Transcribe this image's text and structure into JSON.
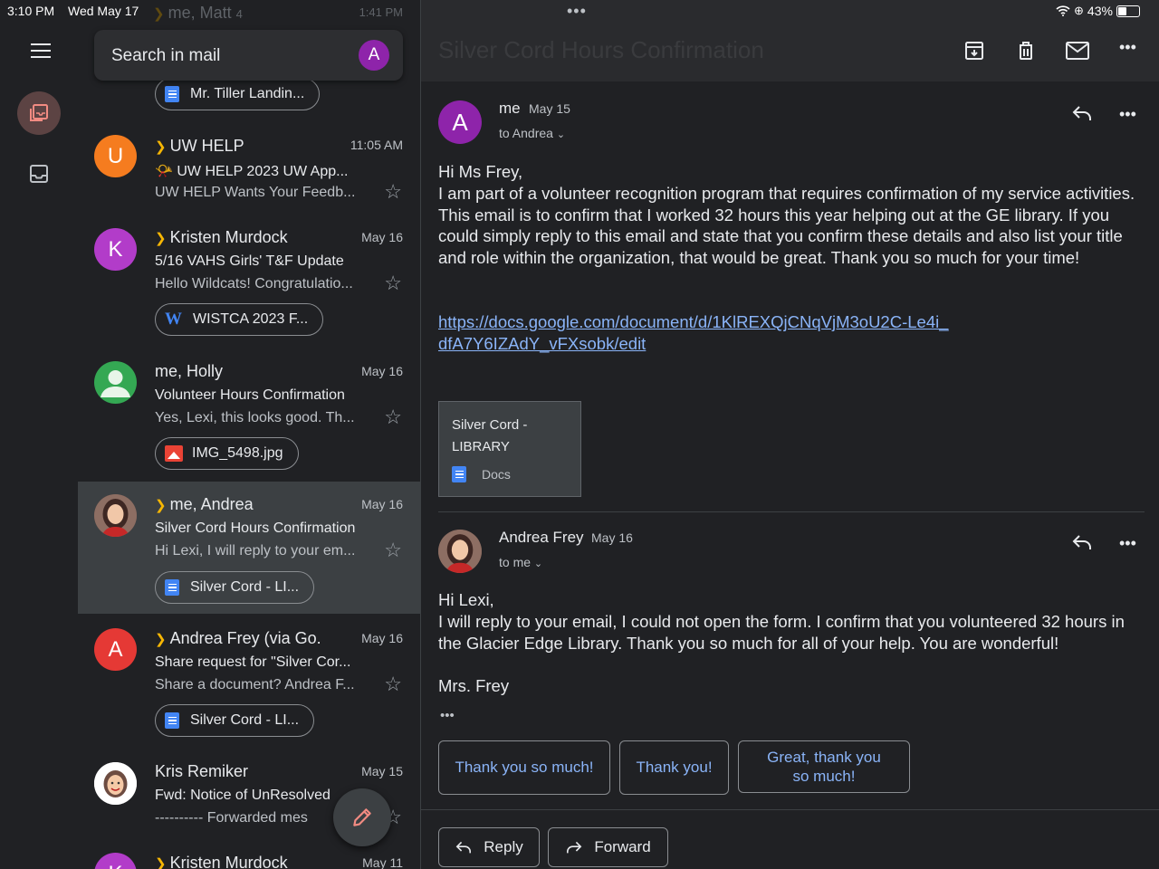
{
  "status_bar": {
    "time": "3:10 PM",
    "date": "Wed May 17",
    "battery": "43%"
  },
  "search": {
    "placeholder": "Search in mail",
    "account_initial": "A"
  },
  "top_partial": {
    "sender": "me, Matt",
    "count": "4",
    "time": "1:41 PM",
    "attachment": "Mr. Tiller Landin..."
  },
  "emails": [
    {
      "avatar_initial": "U",
      "avatar_color": "#f57c1f",
      "sender": "UW HELP",
      "important": true,
      "date": "11:05 AM",
      "subject": "📯 UW HELP 2023 UW App...",
      "snippet": "UW HELP Wants Your Feedb..."
    },
    {
      "avatar_initial": "K",
      "avatar_color": "#b23cc9",
      "sender": "Kristen Murdock",
      "important": true,
      "date": "May 16",
      "subject": "5/16 VAHS Girls' T&F Update",
      "snippet": "Hello Wildcats! Congratulatio...",
      "attachment": "WISTCA 2023 F..."
    },
    {
      "avatar_initial": "",
      "avatar_color": "#34a853",
      "sender": "me, Holly",
      "important": false,
      "date": "May 16",
      "subject": "Volunteer Hours Confirmation",
      "snippet": "Yes, Lexi, this looks good. Th...",
      "attachment": "IMG_5498.jpg"
    },
    {
      "avatar_initial": "",
      "avatar_color": "#7a4a3a",
      "sender": "me, Andrea",
      "important": true,
      "date": "May 16",
      "subject": "Silver Cord Hours Confirmation",
      "snippet": "Hi Lexi, I will reply to your em...",
      "attachment": "Silver Cord - LI..."
    },
    {
      "avatar_initial": "A",
      "avatar_color": "#e53935",
      "sender": "Andrea Frey (via Go.",
      "important": true,
      "date": "May 16",
      "subject": "Share request for \"Silver Cor...",
      "snippet": "Share a document? Andrea F...",
      "attachment": "Silver Cord - LI..."
    },
    {
      "avatar_initial": "",
      "avatar_color": "#ffffff",
      "sender": "Kris Remiker",
      "important": false,
      "date": "May 15",
      "subject": "Fwd: Notice of UnResolved",
      "snippet": "---------- Forwarded mes"
    },
    {
      "avatar_initial": "K",
      "avatar_color": "#b23cc9",
      "sender": "Kristen Murdock",
      "important": true,
      "date": "May 11"
    }
  ],
  "thread": {
    "title": "Silver Cord Hours Confirmation",
    "message1": {
      "avatar_initial": "A",
      "sender": "me",
      "date": "May 15",
      "to": "to Andrea",
      "greeting": "Hi Ms Frey,",
      "body": "I am part of a volunteer recognition program that requires confirmation of my service activities. This email is to confirm that I worked 32 hours this year helping out at the GE library. If you could simply reply to this email and state that you confirm these details and also list your title and role within the organization, that would be great. Thank you so much for your time!",
      "link_line1": "https://docs.google.com/document/d/1KlREXQjCNqVjM3oU2C-Le4i_",
      "link_line2": "dfA7Y6IZAdY_vFXsobk/edit",
      "attachment_title": "Silver Cord - LIBRARY",
      "attachment_type": "Docs"
    },
    "message2": {
      "sender": "Andrea Frey",
      "date": "May 16",
      "to": "to me",
      "line1": "Hi Lexi,",
      "line2": "I will reply to your email, I could not open the form.  I confirm that you volunteered 32 hours in the Glacier Edge Library.  Thank you so much for all of your help.  You are wonderful!",
      "line3": "Mrs. Frey"
    },
    "smart_replies": [
      "Thank you so much!",
      "Thank you!",
      "Great, thank you so much!"
    ],
    "reply_label": "Reply",
    "forward_label": "Forward"
  }
}
